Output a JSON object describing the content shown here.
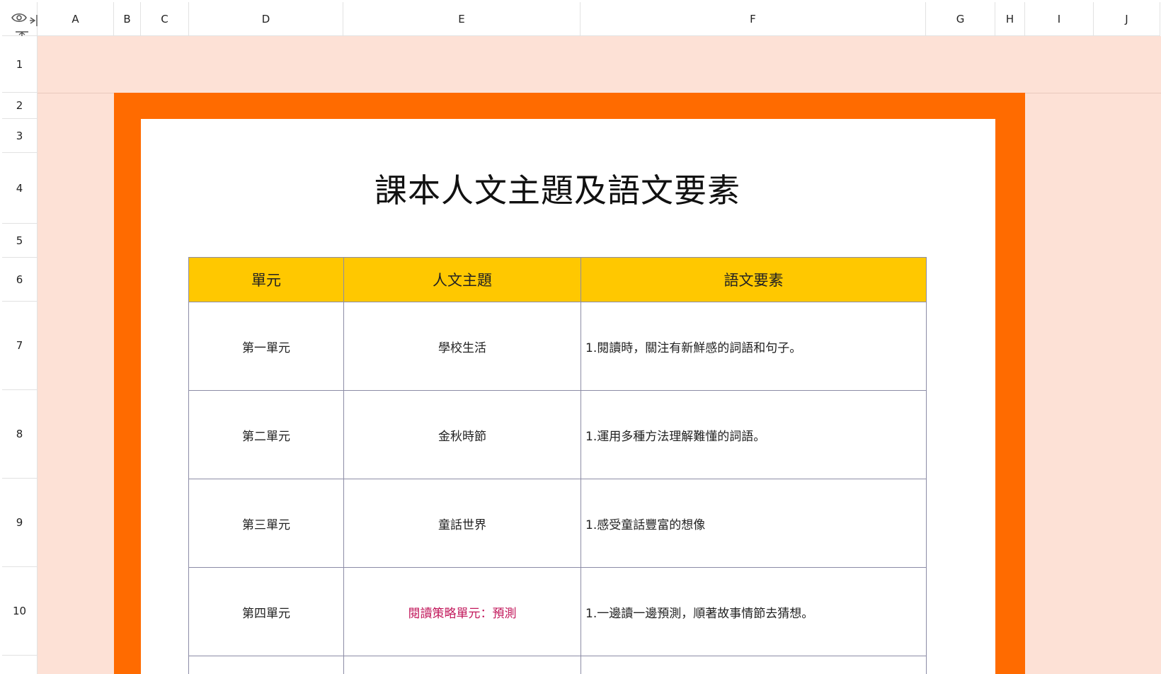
{
  "columns": [
    "A",
    "B",
    "C",
    "D",
    "E",
    "F",
    "G",
    "H",
    "I",
    "J"
  ],
  "rows": [
    "1",
    "2",
    "3",
    "4",
    "5",
    "6",
    "7",
    "8",
    "9",
    "10"
  ],
  "document": {
    "title": "課本人文主題及語文要素"
  },
  "table": {
    "headers": [
      "單元",
      "人文主題",
      "語文要素"
    ],
    "rows": [
      {
        "unit": "第一單元",
        "theme": "學校生活",
        "element": "1.閱讀時，關注有新鮮感的詞語和句子。"
      },
      {
        "unit": "第二單元",
        "theme": "金秋時節",
        "element": "1.運用多種方法理解難懂的詞語。"
      },
      {
        "unit": "第三單元",
        "theme": "童話世界",
        "element": "1.感受童話豐富的想像"
      },
      {
        "unit": "第四單元",
        "theme": "閱讀策略單元：預測",
        "element": "1.一邊讀一邊預測，順著故事情節去猜想。"
      }
    ]
  },
  "colors": {
    "peach_background": "#fde1d6",
    "orange_frame": "#ff6b00",
    "header_fill": "#ffc800",
    "highlight_text": "#c2185b"
  },
  "icons": {
    "corner_view": "eye-icon",
    "column_resize": "resize-horizontal-icon",
    "row_resize": "resize-vertical-icon"
  }
}
